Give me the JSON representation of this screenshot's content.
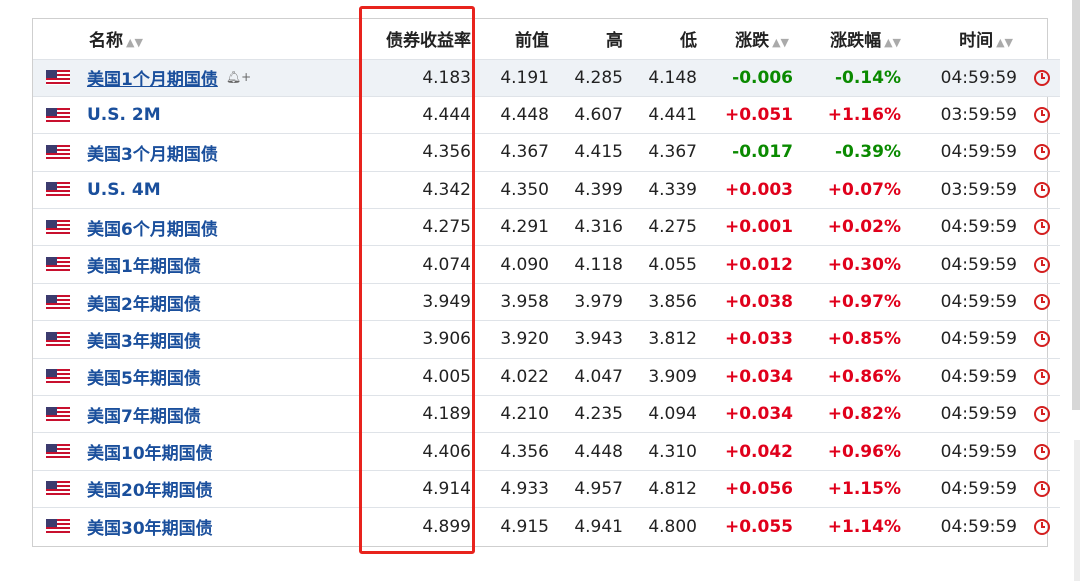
{
  "table": {
    "headers": {
      "name": "名称",
      "yield": "债券收益率",
      "prev": "前值",
      "high": "高",
      "low": "低",
      "change": "涨跌",
      "change_pct": "涨跌幅",
      "time": "时间"
    },
    "rows": [
      {
        "name": "美国1个月期国债",
        "yield": "4.183",
        "prev": "4.191",
        "high": "4.285",
        "low": "4.148",
        "change": "-0.006",
        "change_pct": "-0.14%",
        "time": "04:59:59"
      },
      {
        "name": "U.S. 2M",
        "yield": "4.444",
        "prev": "4.448",
        "high": "4.607",
        "low": "4.441",
        "change": "+0.051",
        "change_pct": "+1.16%",
        "time": "03:59:59"
      },
      {
        "name": "美国3个月期国债",
        "yield": "4.356",
        "prev": "4.367",
        "high": "4.415",
        "low": "4.367",
        "change": "-0.017",
        "change_pct": "-0.39%",
        "time": "04:59:59"
      },
      {
        "name": "U.S. 4M",
        "yield": "4.342",
        "prev": "4.350",
        "high": "4.399",
        "low": "4.339",
        "change": "+0.003",
        "change_pct": "+0.07%",
        "time": "03:59:59"
      },
      {
        "name": "美国6个月期国债",
        "yield": "4.275",
        "prev": "4.291",
        "high": "4.316",
        "low": "4.275",
        "change": "+0.001",
        "change_pct": "+0.02%",
        "time": "04:59:59"
      },
      {
        "name": "美国1年期国债",
        "yield": "4.074",
        "prev": "4.090",
        "high": "4.118",
        "low": "4.055",
        "change": "+0.012",
        "change_pct": "+0.30%",
        "time": "04:59:59"
      },
      {
        "name": "美国2年期国债",
        "yield": "3.949",
        "prev": "3.958",
        "high": "3.979",
        "low": "3.856",
        "change": "+0.038",
        "change_pct": "+0.97%",
        "time": "04:59:59"
      },
      {
        "name": "美国3年期国债",
        "yield": "3.906",
        "prev": "3.920",
        "high": "3.943",
        "low": "3.812",
        "change": "+0.033",
        "change_pct": "+0.85%",
        "time": "04:59:59"
      },
      {
        "name": "美国5年期国债",
        "yield": "4.005",
        "prev": "4.022",
        "high": "4.047",
        "low": "3.909",
        "change": "+0.034",
        "change_pct": "+0.86%",
        "time": "04:59:59"
      },
      {
        "name": "美国7年期国债",
        "yield": "4.189",
        "prev": "4.210",
        "high": "4.235",
        "low": "4.094",
        "change": "+0.034",
        "change_pct": "+0.82%",
        "time": "04:59:59"
      },
      {
        "name": "美国10年期国债",
        "yield": "4.406",
        "prev": "4.356",
        "high": "4.448",
        "low": "4.310",
        "change": "+0.042",
        "change_pct": "+0.96%",
        "time": "04:59:59"
      },
      {
        "name": "美国20年期国债",
        "yield": "4.914",
        "prev": "4.933",
        "high": "4.957",
        "low": "4.812",
        "change": "+0.056",
        "change_pct": "+1.15%",
        "time": "04:59:59"
      },
      {
        "name": "美国30年期国债",
        "yield": "4.899",
        "prev": "4.915",
        "high": "4.941",
        "low": "4.800",
        "change": "+0.055",
        "change_pct": "+1.14%",
        "time": "04:59:59"
      }
    ]
  },
  "icons": {
    "flag": "us-flag-icon",
    "sort": "sort-arrows-icon",
    "bell": "bell-plus-icon",
    "clock": "clock-icon"
  },
  "colors": {
    "positive": "#e0001b",
    "negative": "#0a8a00",
    "link": "#1a4f9c",
    "highlight": "#e8231d"
  }
}
